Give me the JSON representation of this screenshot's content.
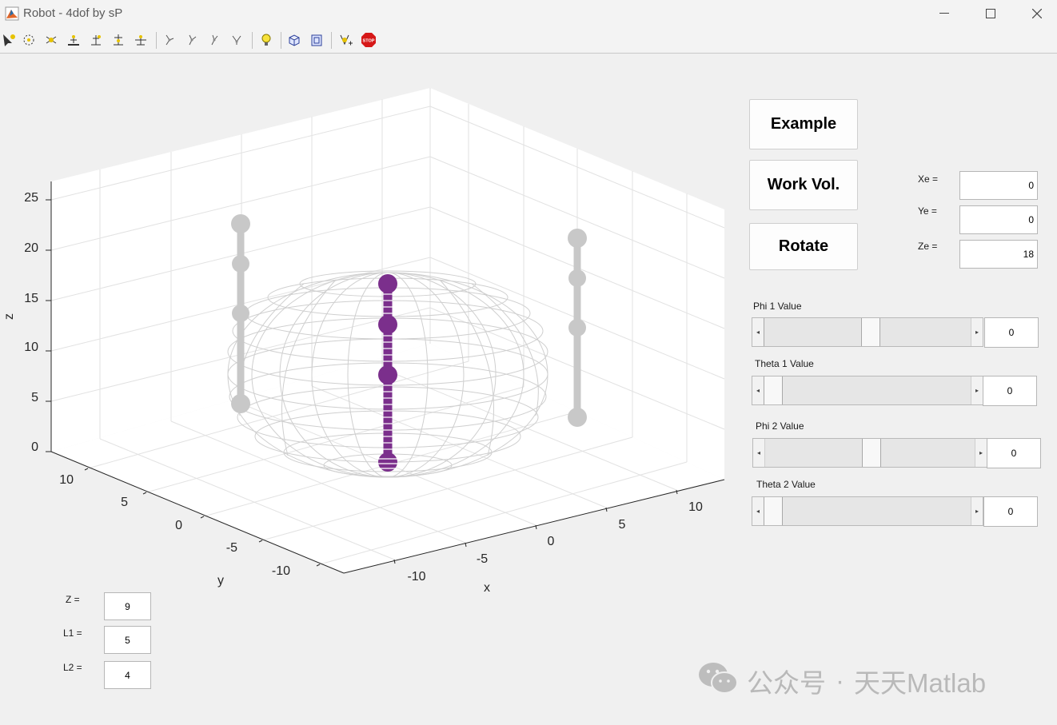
{
  "window": {
    "title": "Robot  - 4dof  by sP",
    "minimize": "—",
    "maximize": "☐",
    "close": "✕"
  },
  "toolbar": {
    "icons": [
      "pointer-tool-icon",
      "zoom-tool-icon",
      "rotate-tool-icon",
      "pan-tool-icon",
      "data-cursor-icon",
      "insert-legend-icon",
      "insert-colorbar-icon",
      "joint-1-icon",
      "joint-2-icon",
      "joint-3-icon",
      "joint-4-icon",
      "light-bulb-icon",
      "view-3d-icon",
      "view-2d-icon",
      "add-tool-icon",
      "stop-icon"
    ]
  },
  "buttons": {
    "example": "Example",
    "work_vol": "Work Vol.",
    "rotate": "Rotate"
  },
  "end_effector": {
    "xe_label": "Xe =",
    "xe_value": "0",
    "ye_label": "Ye =",
    "ye_value": "0",
    "ze_label": "Ze =",
    "ze_value": "18"
  },
  "sliders": [
    {
      "label": "Phi 1 Value",
      "value": "0",
      "position": 0.5
    },
    {
      "label": "Theta 1 Value",
      "value": "0",
      "position": 0.0
    },
    {
      "label": "Phi 2 Value",
      "value": "0",
      "position": 0.5
    },
    {
      "label": "Theta 2 Value",
      "value": "0",
      "position": 0.0
    }
  ],
  "params": {
    "z_label": "Z =",
    "z_value": "9",
    "l1_label": "L1 =",
    "l1_value": "5",
    "l2_label": "L2 =",
    "l2_value": "4"
  },
  "plot": {
    "xlabel": "x",
    "ylabel": "y",
    "zlabel": "z",
    "z_ticks": [
      "0",
      "5",
      "10",
      "15",
      "20",
      "25"
    ],
    "y_ticks": [
      "10",
      "5",
      "0",
      "-5",
      "-10"
    ],
    "x_ticks": [
      "-10",
      "-5",
      "0",
      "5",
      "10"
    ],
    "colors": {
      "arm": "#7b2f8c",
      "ghost": "#c8c8c8",
      "wire": "#d2d2d2",
      "grid": "#e2e2e2"
    }
  },
  "watermark": {
    "prefix": "公众号",
    "separator": "·",
    "name": "天天Matlab"
  }
}
